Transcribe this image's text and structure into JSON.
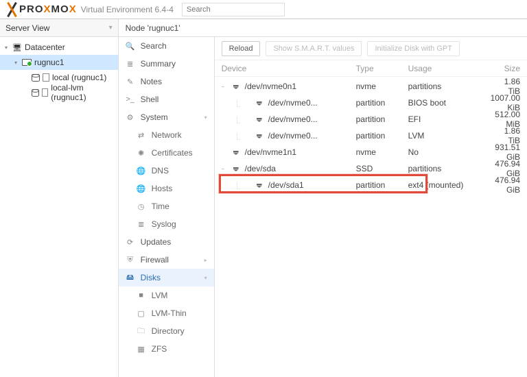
{
  "brand": {
    "pre": "PRO",
    "mid1": "X",
    "mid2": "MO",
    "post": "X",
    "sub": "Virtual Environment 6.4-4"
  },
  "search": {
    "placeholder": "Search"
  },
  "view": {
    "label": "Server View"
  },
  "tree": {
    "dc": "Datacenter",
    "node": "rugnuc1",
    "stores": [
      "local (rugnuc1)",
      "local-lvm (rugnuc1)"
    ]
  },
  "crumb": "Node 'rugnuc1'",
  "nav": {
    "search": "Search",
    "summary": "Summary",
    "notes": "Notes",
    "shell": "Shell",
    "system": "System",
    "network": "Network",
    "certificates": "Certificates",
    "dns": "DNS",
    "hosts": "Hosts",
    "time": "Time",
    "syslog": "Syslog",
    "updates": "Updates",
    "firewall": "Firewall",
    "disks": "Disks",
    "lvm": "LVM",
    "lvmthin": "LVM-Thin",
    "directory": "Directory",
    "zfs": "ZFS"
  },
  "toolbar": {
    "reload": "Reload",
    "smart": "Show S.M.A.R.T. values",
    "init": "Initialize Disk with GPT"
  },
  "grid": {
    "headers": {
      "device": "Device",
      "type": "Type",
      "usage": "Usage",
      "size": "Size"
    },
    "rows": [
      {
        "indent": 0,
        "caret": "–",
        "device": "/dev/nvme0n1",
        "type": "nvme",
        "usage": "partitions",
        "size": "1.86 TiB"
      },
      {
        "indent": 1,
        "caret": "",
        "device": "/dev/nvme0...",
        "type": "partition",
        "usage": "BIOS boot",
        "size": "1007.00 KiB"
      },
      {
        "indent": 1,
        "caret": "",
        "device": "/dev/nvme0...",
        "type": "partition",
        "usage": "EFI",
        "size": "512.00 MiB"
      },
      {
        "indent": 1,
        "caret": "",
        "device": "/dev/nvme0...",
        "type": "partition",
        "usage": "LVM",
        "size": "1.86 TiB"
      },
      {
        "indent": 0,
        "caret": "",
        "device": "/dev/nvme1n1",
        "type": "nvme",
        "usage": "No",
        "size": "931.51 GiB"
      },
      {
        "indent": 0,
        "caret": "–",
        "device": "/dev/sda",
        "type": "SSD",
        "usage": "partitions",
        "size": "476.94 GiB"
      },
      {
        "indent": 1,
        "caret": "",
        "device": "/dev/sda1",
        "type": "partition",
        "usage": "ext4 (mounted)",
        "size": "476.94 GiB"
      }
    ]
  },
  "chart_data": null
}
